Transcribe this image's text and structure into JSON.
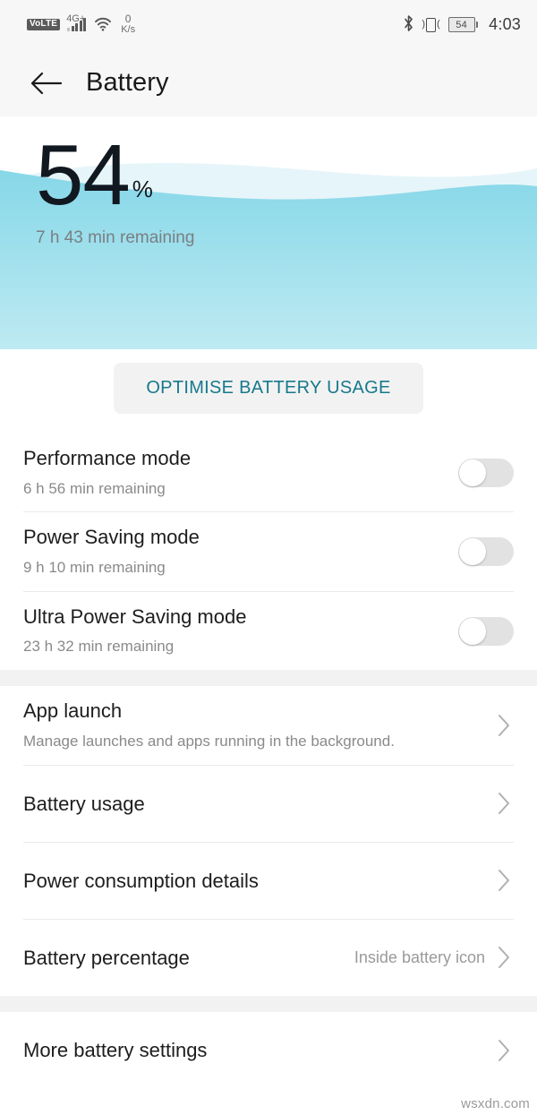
{
  "statusbar": {
    "volte": "VoLTE",
    "network_type": "4G+",
    "wifi_icon": "wifi-icon",
    "netspeed_value": "0",
    "netspeed_unit": "K/s",
    "bluetooth_icon": "bluetooth-icon",
    "vibrate_icon": "vibrate-icon",
    "battery_level": "54",
    "time": "4:03"
  },
  "header": {
    "back_icon": "back-arrow-icon",
    "title": "Battery"
  },
  "hero": {
    "percent": "54",
    "percent_symbol": "%",
    "remaining": "7 h 43 min remaining",
    "wave_color": "#8BD8E8",
    "wave_color_light": "#E6F5F9"
  },
  "optimise": {
    "label": "OPTIMISE BATTERY USAGE",
    "color": "#16798C"
  },
  "modes": [
    {
      "title": "Performance mode",
      "sub": "6 h 56 min remaining",
      "enabled": false
    },
    {
      "title": "Power Saving mode",
      "sub": "9 h 10 min remaining",
      "enabled": false
    },
    {
      "title": "Ultra Power Saving mode",
      "sub": "23 h 32 min remaining",
      "enabled": false
    }
  ],
  "links": [
    {
      "title": "App launch",
      "sub": "Manage launches and apps running in the background.",
      "value": ""
    },
    {
      "title": "Battery usage",
      "sub": "",
      "value": ""
    },
    {
      "title": "Power consumption details",
      "sub": "",
      "value": ""
    },
    {
      "title": "Battery percentage",
      "sub": "",
      "value": "Inside battery icon"
    }
  ],
  "footer_links": [
    {
      "title": "More battery settings",
      "sub": "",
      "value": ""
    }
  ],
  "watermark": "wsxdn.com"
}
